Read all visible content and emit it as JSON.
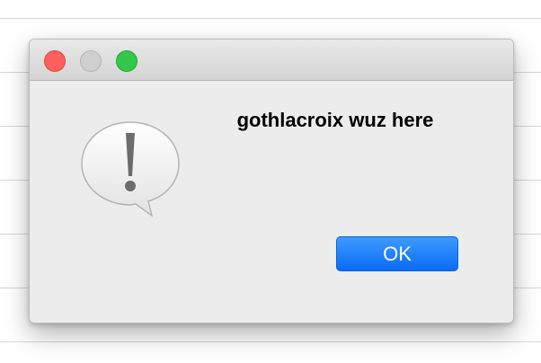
{
  "dialog": {
    "message": "gothlacroix wuz here",
    "ok_label": "OK",
    "icon": "exclamation-speech-bubble-icon"
  },
  "window_controls": {
    "close_color": "#fc605c",
    "minimize_color": "#d0d0d0",
    "zoom_color": "#34c84a"
  },
  "colors": {
    "button_accent": "#1a7cff",
    "dialog_background": "#ececec"
  }
}
